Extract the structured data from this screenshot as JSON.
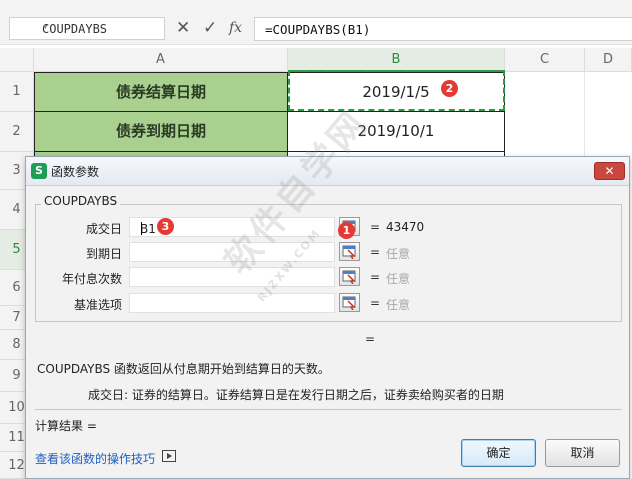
{
  "formula_bar": {
    "name_box": "COUPDAYBS",
    "cancel_glyph": "✕",
    "confirm_glyph": "✓",
    "fx_label": "fx",
    "formula": "=COUPDAYBS(B1)"
  },
  "sheet": {
    "columns": [
      "A",
      "B",
      "C",
      "D"
    ],
    "rows": [
      "1",
      "2",
      "3",
      "4",
      "5",
      "6",
      "7",
      "8",
      "9",
      "10",
      "11",
      "12"
    ],
    "cells": {
      "A1": "债券结算日期",
      "B1": "2019/1/5",
      "A2": "债券到期日期",
      "B2": "2019/10/1"
    },
    "selected_column": "B",
    "accent_color": "#a9d08e"
  },
  "badges": {
    "b1": "1",
    "b2": "2",
    "b3": "3"
  },
  "dialog": {
    "title": "函数参数",
    "app_icon": "S",
    "close_glyph": "✕",
    "function_name": "COUPDAYBS",
    "params": [
      {
        "label": "成交日",
        "value": "B1",
        "result": "43470"
      },
      {
        "label": "到期日",
        "value": "",
        "result": "任意"
      },
      {
        "label": "年付息次数",
        "value": "",
        "result": "任意"
      },
      {
        "label": "基准选项",
        "value": "",
        "result": "任意"
      }
    ],
    "equals": "=",
    "description": "COUPDAYBS 函数返回从付息期开始到结算日的天数。",
    "arg_description": "成交日:  证券的结算日。证券结算日是在发行日期之后，证券卖给购买者的日期",
    "result_label": "计算结果  =",
    "help_link": "查看该函数的操作技巧",
    "ok_label": "确定",
    "cancel_label": "取消"
  },
  "watermark": {
    "main": "软件自学网",
    "sub": "RJZXW.COM"
  }
}
